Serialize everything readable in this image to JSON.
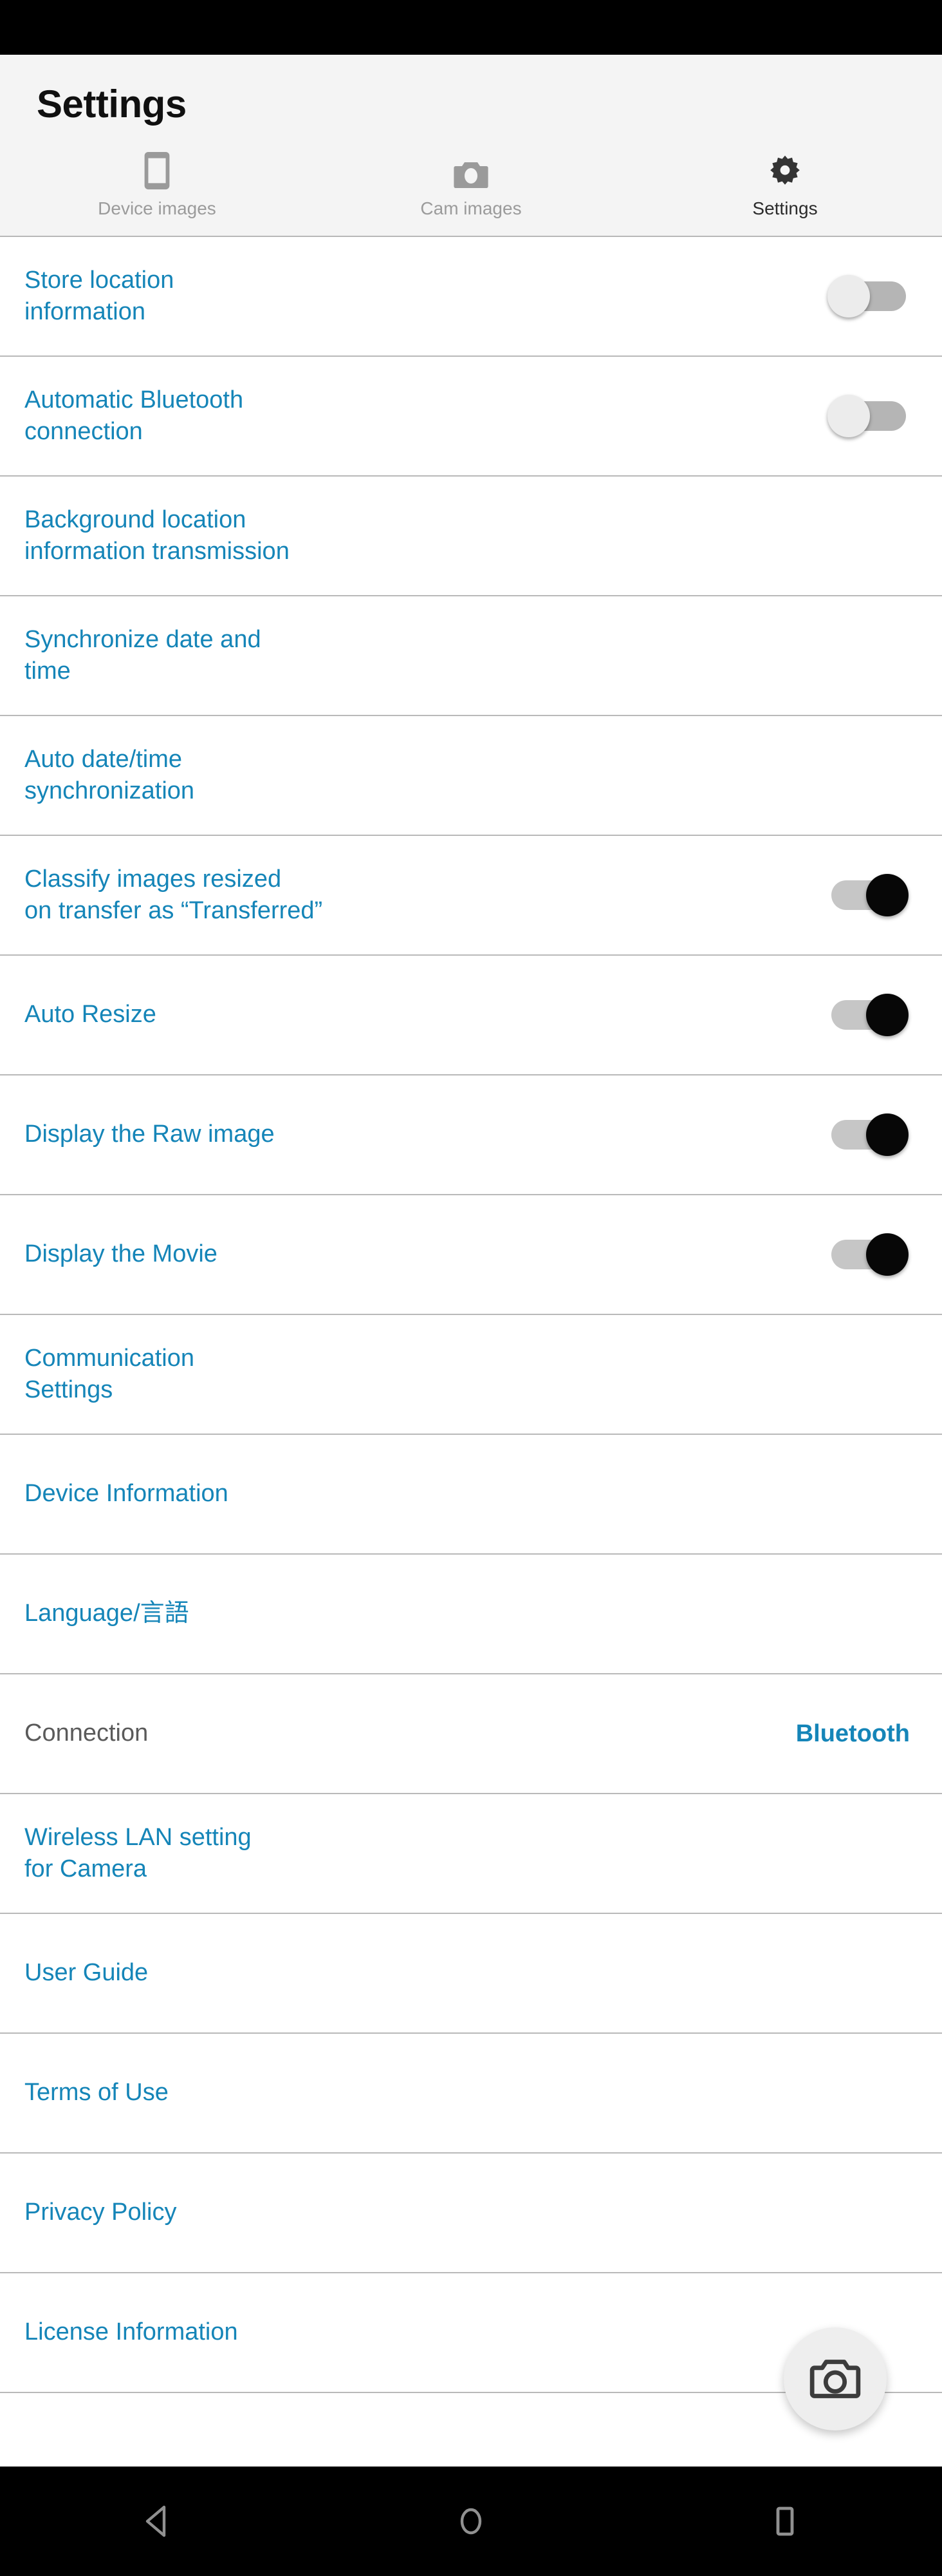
{
  "window": {
    "status_bar_color": "#000000",
    "nav_bar_color": "#000000",
    "accent_color": "#1585b8",
    "header_bg": "#f4f4f4"
  },
  "header": {
    "title": "Settings"
  },
  "tabs": [
    {
      "label": "Device images",
      "icon": "phone-icon",
      "active": false
    },
    {
      "label": "Cam images",
      "icon": "camera-icon",
      "active": false
    },
    {
      "label": "Settings",
      "icon": "gear-icon",
      "active": true
    }
  ],
  "settings": [
    {
      "label": "Store location\ninformation",
      "control": "toggle",
      "state": "off"
    },
    {
      "label": "Automatic Bluetooth\nconnection",
      "control": "toggle",
      "state": "off"
    },
    {
      "label": "Background location\ninformation transmission",
      "control": "none"
    },
    {
      "label": "Synchronize date and\ntime",
      "control": "none"
    },
    {
      "label": "Auto date/time\nsynchronization",
      "control": "none"
    },
    {
      "label": "Classify images resized\non transfer as “Transferred”",
      "control": "toggle",
      "state": "on"
    },
    {
      "label": "Auto Resize",
      "control": "toggle",
      "state": "on"
    },
    {
      "label": "Display the Raw image",
      "control": "toggle",
      "state": "on"
    },
    {
      "label": "Display the Movie",
      "control": "toggle",
      "state": "on"
    },
    {
      "label": "Communication\nSettings",
      "control": "none"
    },
    {
      "label": "Device Information",
      "control": "none"
    },
    {
      "label": "Language/言語",
      "control": "none"
    },
    {
      "label": "Connection",
      "muted": true,
      "control": "value",
      "value": "Bluetooth"
    },
    {
      "label": "Wireless LAN setting\nfor Camera",
      "control": "none"
    },
    {
      "label": "User Guide",
      "control": "none"
    },
    {
      "label": "Terms of Use",
      "control": "none"
    },
    {
      "label": "Privacy Policy",
      "control": "none"
    },
    {
      "label": "License Information",
      "control": "none"
    }
  ],
  "fab": {
    "icon": "camera-icon"
  },
  "navbar": {
    "buttons": [
      {
        "icon": "back-triangle-icon"
      },
      {
        "icon": "home-circle-icon"
      },
      {
        "icon": "recents-square-icon"
      }
    ]
  }
}
